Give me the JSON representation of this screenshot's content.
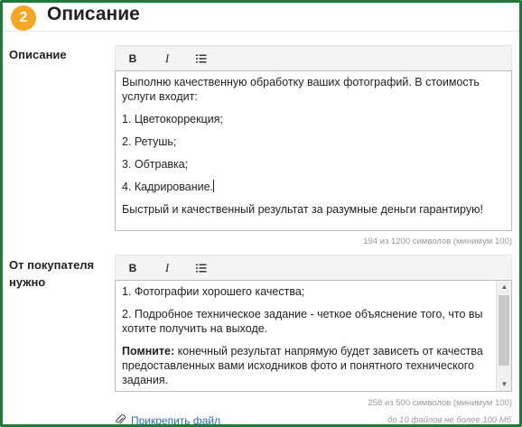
{
  "section": {
    "step_number": "2",
    "title": "Описание"
  },
  "toolbar": {
    "bold_label": "B",
    "italic_label": "I",
    "list_icon": "list-icon"
  },
  "description_field": {
    "label": "Описание",
    "paragraphs": [
      "Выполню качественную обработку ваших фотографий. В стоимость услуги входит:",
      "1. Цветокоррекция;",
      "2. Ретушь;",
      "3. Обтравка;",
      "4. Кадрирование.",
      "Быстрый и качественный результат за разумные деньги гарантирую!"
    ],
    "counter": "194 из 1200 символов (минимум 100)"
  },
  "buyer_field": {
    "label": "От покупателя нужно",
    "paragraphs": [
      "1. Фотографии хорошего качества;",
      "2. Подробное техническое задание - четкое объяснение того, что вы хотите получить на выходе."
    ],
    "note_bold": "Помните:",
    "note_text": " конечный результат напрямую будет зависеть от качества предоставленных вами исходников фото и понятного технического задания.",
    "counter": "258 из 500 символов (минимум 100)"
  },
  "attachment": {
    "link_label": "Прикрепить файл",
    "note": "до 10 файлов не более 100 Мб",
    "icon": "paperclip-icon"
  },
  "colors": {
    "frame": "#1f7a3a",
    "badge": "#f5a623",
    "link": "#2a6cc4"
  }
}
